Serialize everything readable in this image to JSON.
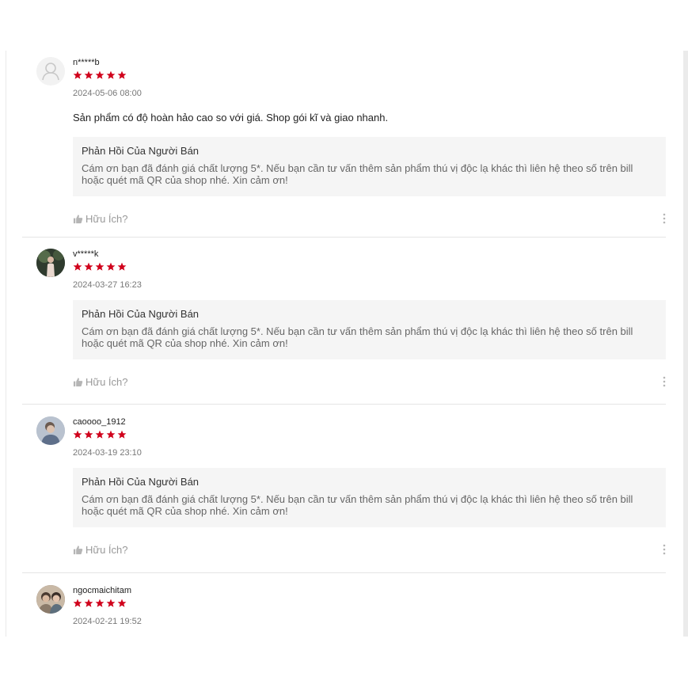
{
  "colors": {
    "star": "#d0011b",
    "reply_bg": "#f5f5f5",
    "muted": "#999999"
  },
  "icons": {
    "rating": "star-icon",
    "helpful": "thumbs-up-icon",
    "more": "more-vertical-icon",
    "avatar_default": "user-icon"
  },
  "reviews": [
    {
      "username": "n*****b",
      "rating": 5,
      "date": "2024-05-06 08:00",
      "comment": "Sản phẩm có độ hoàn hảo cao so với giá. Shop gói kĩ và giao nhanh.",
      "reply_title": "Phản Hồi Của Người Bán",
      "reply_text": "Cám ơn bạn đã đánh giá chất lượng 5*. Nếu bạn cần tư vấn thêm sản phẩm thú vị độc lạ khác thì liên hệ theo số trên bill hoặc quét mã QR của shop nhé. Xin cảm ơn!",
      "helpful_label": "Hữu Ích?"
    },
    {
      "username": "v*****k",
      "rating": 5,
      "date": "2024-03-27 16:23",
      "reply_title": "Phản Hồi Của Người Bán",
      "reply_text": "Cám ơn bạn đã đánh giá chất lượng 5*. Nếu bạn cần tư vấn thêm sản phẩm thú vị độc lạ khác thì liên hệ theo số trên bill hoặc quét mã QR của shop nhé. Xin cảm ơn!",
      "helpful_label": "Hữu Ích?"
    },
    {
      "username": "caoooo_1912",
      "rating": 5,
      "date": "2024-03-19 23:10",
      "reply_title": "Phản Hồi Của Người Bán",
      "reply_text": "Cám ơn bạn đã đánh giá chất lượng 5*. Nếu bạn cần tư vấn thêm sản phẩm thú vị độc lạ khác thì liên hệ theo số trên bill hoặc quét mã QR của shop nhé. Xin cảm ơn!",
      "helpful_label": "Hữu Ích?"
    },
    {
      "username": "ngocmaichitam",
      "rating": 5,
      "date": "2024-02-21 19:52"
    }
  ]
}
